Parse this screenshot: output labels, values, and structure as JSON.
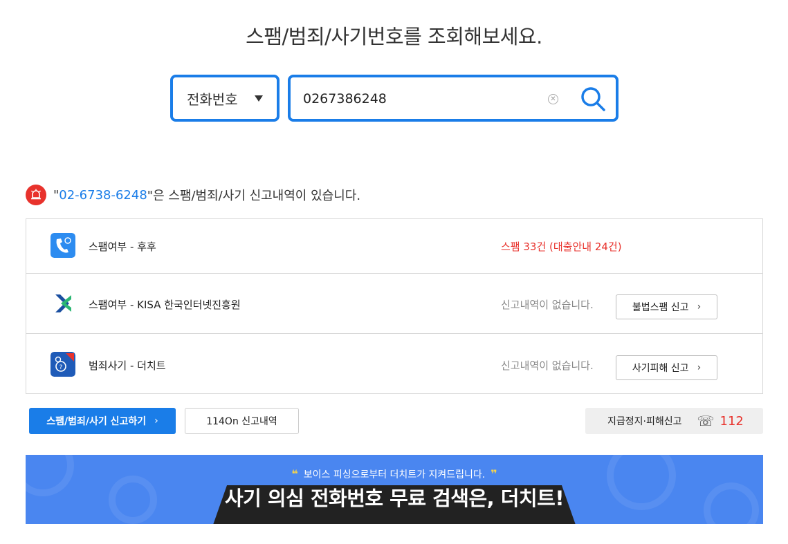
{
  "page": {
    "title": "스팸/범죄/사기번호를 조회해보세요."
  },
  "search": {
    "type_label": "전화번호",
    "value": "0267386248",
    "clear_symbol": "✕"
  },
  "alert": {
    "quote_open": "\"",
    "number": "02-6738-6248",
    "message": "\"은 스팸/범죄/사기 신고내역이 있습니다."
  },
  "results": [
    {
      "name": "스팸여부 - 후후",
      "status": "스팸 33건 (대출안내 24건)",
      "status_color": "#e8322c",
      "icon": "whowho-app-icon"
    },
    {
      "name": "스팸여부 - KISA 한국인터넷진흥원",
      "status": "신고내역이 없습니다.",
      "button_label": "불법스팸 신고",
      "icon": "kisa-logo-icon"
    },
    {
      "name": "범죄사기 - 더치트",
      "status": "신고내역이 없습니다.",
      "button_label": "사기피해 신고",
      "icon": "thecheat-app-icon"
    }
  ],
  "actions": {
    "report_label": "스팸/범죄/사기 신고하기",
    "history_label": "114On 신고내역",
    "emergency_label": "지급정지·피해신고",
    "emergency_number": "112"
  },
  "banner": {
    "subtitle": "보이스 피싱으로부터 더치트가 지켜드립니다.",
    "headline": "사기 의심 전화번호 무료 검색은, 더치트!"
  },
  "colors": {
    "accent": "#1a7de8",
    "danger": "#e8322c",
    "banner_bg": "#4a86f0"
  }
}
